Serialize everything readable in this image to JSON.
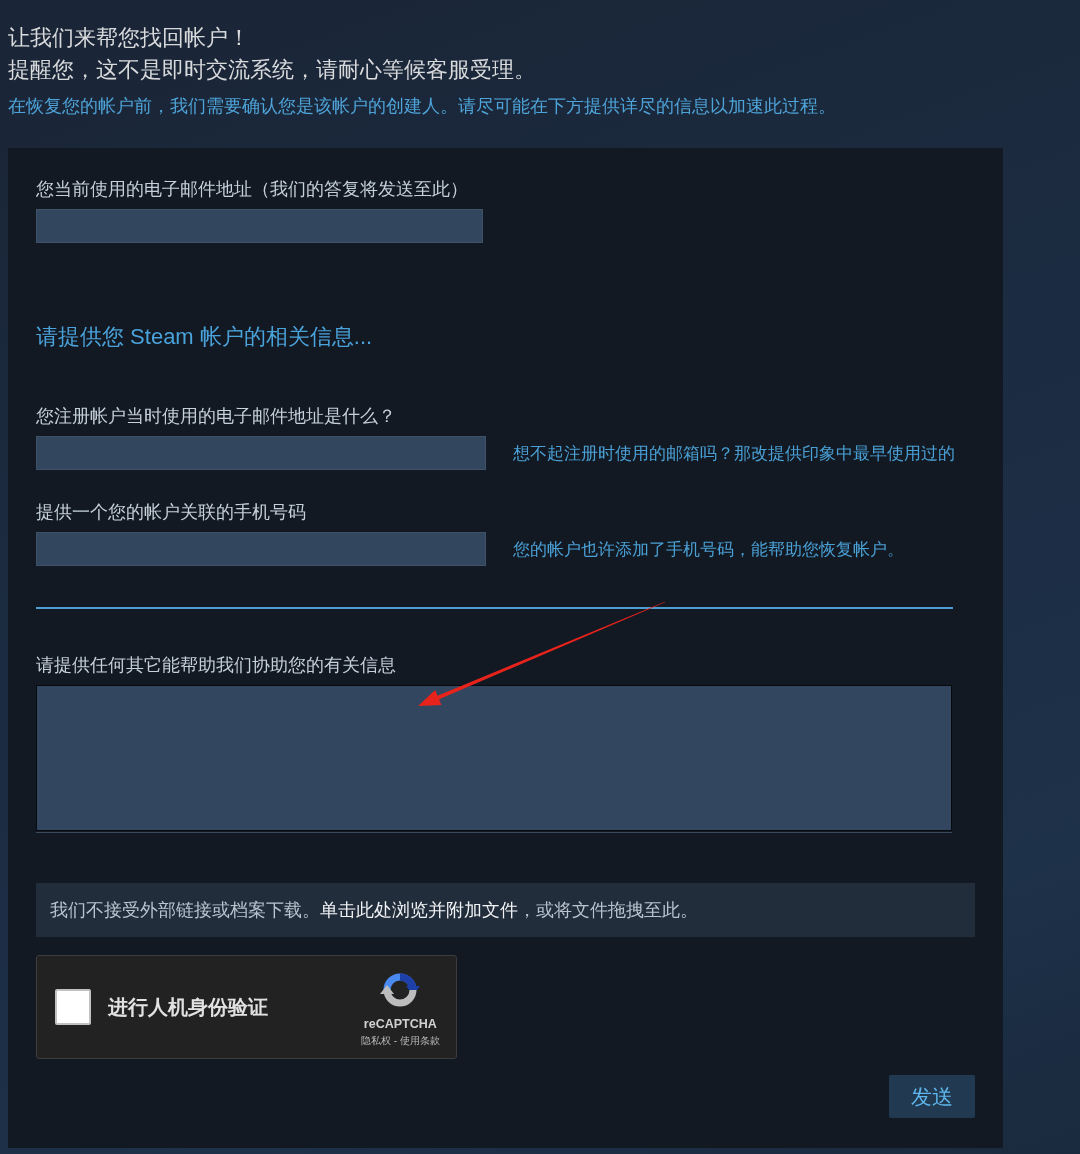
{
  "intro": {
    "title": "让我们来帮您找回帐户！",
    "notice": "提醒您，这不是即时交流系统，请耐心等候客服受理。",
    "instructions": "在恢复您的帐户前，我们需要确认您是该帐户的创建人。请尽可能在下方提供详尽的信息以加速此过程。"
  },
  "form": {
    "contact_email": {
      "label": "您当前使用的电子邮件地址（我们的答复将发送至此）"
    },
    "section_heading": "请提供您 Steam 帐户的相关信息...",
    "account_fields": [
      {
        "label": "您注册帐户当时使用的电子邮件地址是什么？",
        "hint": "想不起注册时使用的邮箱吗？那改提供印象中最早使用过的"
      },
      {
        "label": "提供一个您的帐户关联的手机号码",
        "hint": "您的帐户也许添加了手机号码，能帮助您恢复帐户。"
      }
    ],
    "details": {
      "label": "请提供任何其它能帮助我们协助您的有关信息"
    },
    "attachment": {
      "text_before": "我们不接受外部链接或档案下载。",
      "link": "单击此处浏览并附加文件",
      "text_after": "，或将文件拖拽至此。"
    },
    "captcha": {
      "checked": false,
      "label": "进行人机身份验证",
      "brand": "reCAPTCHA",
      "privacy_link": "隐私权",
      "separator": "-",
      "terms_link": "使用条款"
    },
    "submit_button": "发送"
  }
}
